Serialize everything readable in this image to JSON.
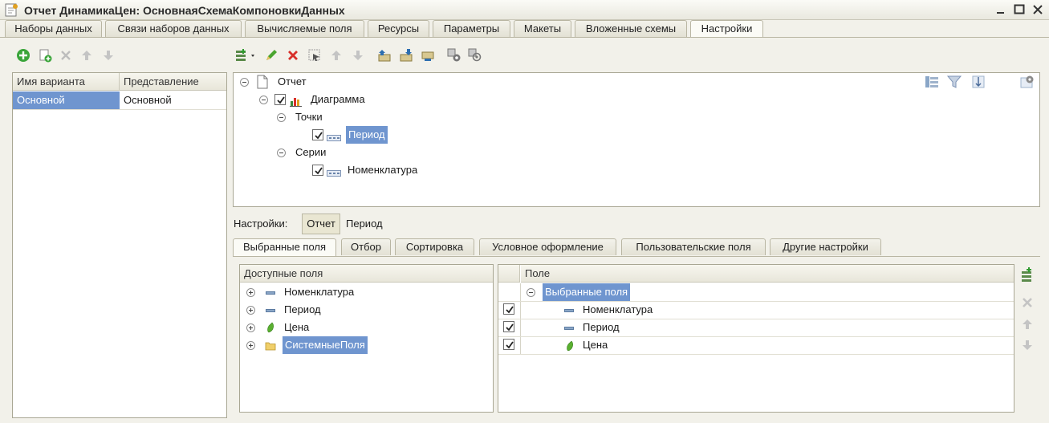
{
  "window": {
    "title": "Отчет ДинамикаЦен: ОсновнаяСхемаКомпоновкиДанных"
  },
  "tabs": [
    {
      "label": "Наборы данных"
    },
    {
      "label": "Связи наборов данных"
    },
    {
      "label": "Вычисляемые поля"
    },
    {
      "label": "Ресурсы"
    },
    {
      "label": "Параметры"
    },
    {
      "label": "Макеты"
    },
    {
      "label": "Вложенные схемы"
    },
    {
      "label": "Настройки"
    }
  ],
  "variants": {
    "columns": [
      "Имя варианта",
      "Представление"
    ],
    "rows": [
      {
        "name": "Основной",
        "view": "Основной"
      }
    ]
  },
  "structure": {
    "root": "Отчет",
    "chart": "Диаграмма",
    "points_label": "Точки",
    "point_field": "Период",
    "series_label": "Серии",
    "series_field": "Номенклатура"
  },
  "settings": {
    "label": "Настройки:",
    "active_button": "Отчет",
    "other": "Период"
  },
  "subtabs": [
    {
      "label": "Выбранные поля"
    },
    {
      "label": "Отбор"
    },
    {
      "label": "Сортировка"
    },
    {
      "label": "Условное оформление"
    },
    {
      "label": "Пользовательские поля"
    },
    {
      "label": "Другие настройки"
    }
  ],
  "available_fields": {
    "header": "Доступные поля",
    "items": [
      {
        "label": "Номенклатура",
        "icon": "field-icon"
      },
      {
        "label": "Период",
        "icon": "field-icon"
      },
      {
        "label": "Цена",
        "icon": "resource-icon"
      },
      {
        "label": "СистемныеПоля",
        "icon": "folder-icon"
      }
    ]
  },
  "selected_fields": {
    "header": "Поле",
    "group": "Выбранные поля",
    "items": [
      {
        "label": "Номенклатура",
        "checked": true
      },
      {
        "label": "Период",
        "checked": true
      },
      {
        "label": "Цена",
        "checked": true
      }
    ]
  },
  "colors": {
    "selection": "#6f95cf",
    "accent_green": "#3aa53a",
    "delete_red": "#d8302a"
  }
}
